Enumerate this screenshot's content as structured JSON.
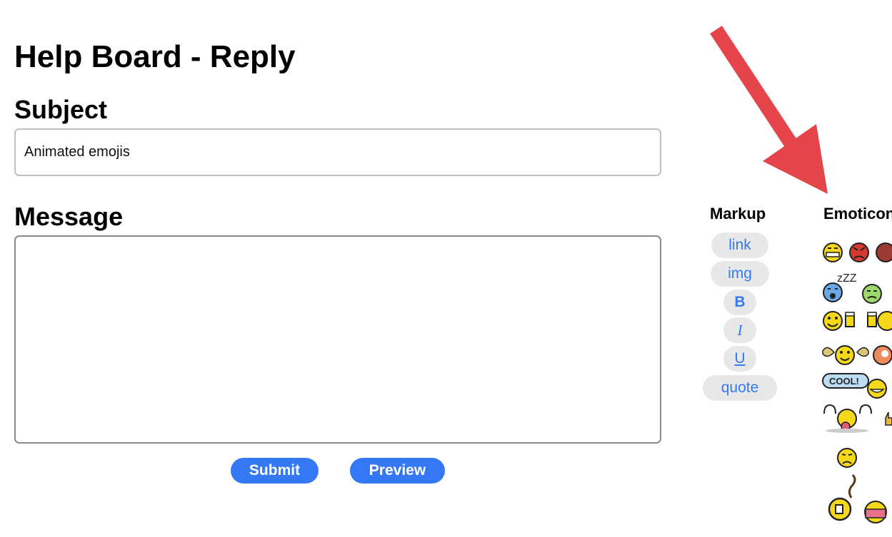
{
  "page": {
    "title": "Help Board - Reply"
  },
  "form": {
    "subject_label": "Subject",
    "subject_value": "Animated emojis",
    "message_label": "Message",
    "message_value": "",
    "submit_label": "Submit",
    "preview_label": "Preview"
  },
  "markup": {
    "heading": "Markup",
    "buttons": [
      "link",
      "img",
      "B",
      "I",
      "U",
      "quote"
    ]
  },
  "emoticons": {
    "heading": "Emoticons",
    "items": [
      "grin-emoticon",
      "angry-red-emoticon",
      "devil-emoticon",
      "sleeping-blue-emoticon",
      "sick-green-emoticon",
      "beer-cheers-emoticon",
      "winged-smiley-emoticon",
      "orange-emoticon",
      "cool-speech-emoticon",
      "laughing-emoticon",
      "tongue-wave-emoticon",
      "thumbs-up-emoticon",
      "worried-emoticon",
      "smoking-emoticon",
      "blushing-emoticon"
    ],
    "cool_text": "COOL!",
    "zzz_text": "zZZ"
  },
  "colors": {
    "accent": "#3478f6",
    "arrow": "#e5444a",
    "pill_bg": "#e8e8e8"
  }
}
